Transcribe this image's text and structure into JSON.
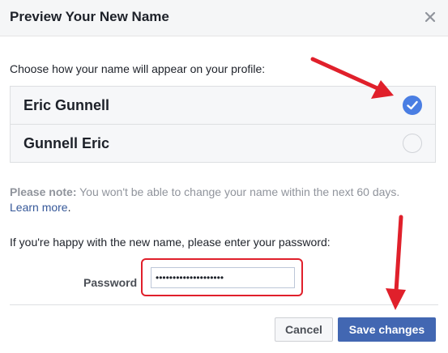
{
  "dialog": {
    "title": "Preview Your New Name",
    "close_icon": "close-icon"
  },
  "name_choice": {
    "prompt": "Choose how your name will appear on your profile:",
    "options": [
      {
        "label": "Eric Gunnell",
        "selected": true
      },
      {
        "label": "Gunnell Eric",
        "selected": false
      }
    ]
  },
  "note": {
    "prefix": "Please note:",
    "text": " You won't be able to change your name within the next 60 days.",
    "link_label": "Learn more",
    "suffix": "."
  },
  "password": {
    "instruction": "If you're happy with the new name, please enter your password:",
    "label": "Password",
    "value": "••••••••••••••••••••"
  },
  "actions": {
    "cancel_label": "Cancel",
    "save_label": "Save changes"
  },
  "colors": {
    "primary": "#4267b2",
    "radio_checked": "#4a7ee3",
    "annotation": "#e0202b",
    "link": "#365899"
  }
}
